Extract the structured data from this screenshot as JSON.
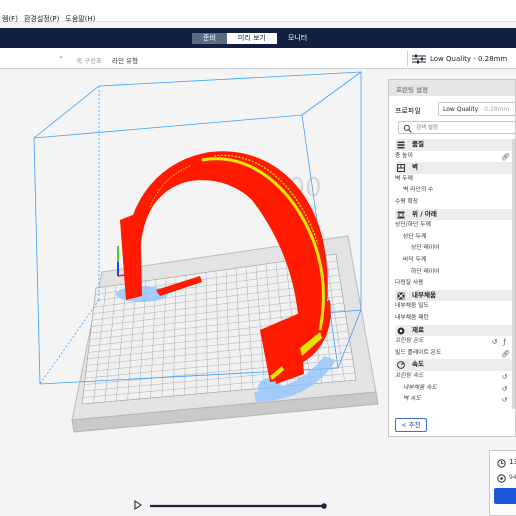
{
  "menu": [
    "렘(F)",
    "환경설정(P)",
    "도움말(H)"
  ],
  "stages": [
    {
      "label": "준비",
      "state": "semi"
    },
    {
      "label": "미리 보기",
      "state": "active"
    },
    {
      "label": "모니터",
      "state": "normal"
    }
  ],
  "toolbar": {
    "color_scheme_label": "색 구성표",
    "color_scheme_value": "라인 유형",
    "quality": "Low Quality - 0.28mm"
  },
  "panel": {
    "title": "프린팅 설정",
    "profile_label": "프로파일",
    "profile_value": "Low Quality",
    "profile_suffix": "- 0.28mm",
    "search_placeholder": "검색 설정",
    "recommend_label": "< 추천"
  },
  "settings": [
    {
      "type": "cat",
      "icon": "quality-icon",
      "label": "품질"
    },
    {
      "type": "row",
      "label": "층 높이",
      "indent": 0,
      "italic": false,
      "actions": [
        "link"
      ]
    },
    {
      "type": "cat",
      "icon": "wall-icon",
      "label": "벽"
    },
    {
      "type": "row",
      "label": "벽 두께",
      "indent": 0,
      "italic": false,
      "actions": []
    },
    {
      "type": "row",
      "label": "벽 라인의 수",
      "indent": 1,
      "italic": false,
      "actions": []
    },
    {
      "type": "row",
      "label": "수평 확장",
      "indent": 0,
      "italic": false,
      "actions": []
    },
    {
      "type": "cat",
      "icon": "topbottom-icon",
      "label": "위 / 아래"
    },
    {
      "type": "row",
      "label": "상단/하단 두께",
      "indent": 0,
      "italic": false,
      "actions": []
    },
    {
      "type": "row",
      "label": "상단 두께",
      "indent": 1,
      "italic": false,
      "actions": []
    },
    {
      "type": "row",
      "label": "상단 레이어",
      "indent": 2,
      "italic": false,
      "actions": []
    },
    {
      "type": "row",
      "label": "바닥 두께",
      "indent": 1,
      "italic": false,
      "actions": []
    },
    {
      "type": "row",
      "label": "하단 레이어",
      "indent": 2,
      "italic": false,
      "actions": []
    },
    {
      "type": "row",
      "label": "다림질 사용",
      "indent": 0,
      "italic": false,
      "actions": []
    },
    {
      "type": "cat",
      "icon": "infill-icon",
      "label": "내부채움"
    },
    {
      "type": "row",
      "label": "내부채움 밀도",
      "indent": 0,
      "italic": false,
      "actions": []
    },
    {
      "type": "row",
      "label": "내부채움 패턴",
      "indent": 0,
      "italic": false,
      "actions": []
    },
    {
      "type": "cat",
      "icon": "material-icon",
      "label": "재료"
    },
    {
      "type": "row",
      "label": "프린팅 온도",
      "indent": 0,
      "italic": true,
      "actions": [
        "reset",
        "fx"
      ]
    },
    {
      "type": "row",
      "label": "빌드 플레이트 온도",
      "indent": 0,
      "italic": false,
      "actions": [
        "link"
      ]
    },
    {
      "type": "cat",
      "icon": "speed-icon",
      "label": "속도"
    },
    {
      "type": "row",
      "label": "프린팅 속도",
      "indent": 0,
      "italic": true,
      "actions": [
        "reset"
      ]
    },
    {
      "type": "row",
      "label": "내부채움 속도",
      "indent": 1,
      "italic": true,
      "actions": [
        "reset"
      ]
    },
    {
      "type": "row",
      "label": "벽 속도",
      "indent": 1,
      "italic": true,
      "actions": [
        "reset"
      ]
    }
  ],
  "print_info": {
    "time": "13",
    "weight": "94"
  },
  "watermark": {
    "text1": "300",
    "text2": "ool"
  },
  "colors": {
    "accent": "#1f57d6",
    "stage_bar": "#0f2040",
    "model_red": "#ff1a00",
    "model_yellow": "#e6e600",
    "shadow_blue": "#8ec3ff",
    "volume_line": "#3aa0ff"
  }
}
